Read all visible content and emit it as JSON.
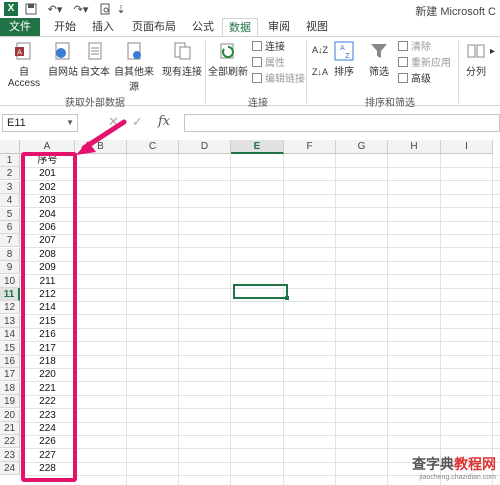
{
  "app": {
    "title": "新建 Microsoft C",
    "logo": "X"
  },
  "quick_access": {
    "icons": [
      "save-icon",
      "undo-icon",
      "redo-icon",
      "print-preview-icon"
    ]
  },
  "tabs": [
    {
      "label": "文件"
    },
    {
      "label": "开始"
    },
    {
      "label": "插入"
    },
    {
      "label": "页面布局"
    },
    {
      "label": "公式"
    },
    {
      "label": "数据"
    },
    {
      "label": "审阅"
    },
    {
      "label": "视图"
    }
  ],
  "active_tab": "数据",
  "ribbon": {
    "get_external": {
      "buttons": [
        "自 Access",
        "自网站",
        "自文本",
        "自其他来源",
        "现有连接"
      ],
      "label": "获取外部数据"
    },
    "connections": {
      "refresh": "全部刷新",
      "items": [
        "连接",
        "属性",
        "编辑链接"
      ],
      "label": "连接"
    },
    "sort_filter": {
      "sort": "排序",
      "filter": "筛选",
      "items": [
        "清除",
        "重新应用",
        "高级"
      ],
      "label": "排序和筛选"
    },
    "tools": {
      "split": "分列"
    }
  },
  "formula_bar": {
    "name_box": "E11",
    "fx": "fx",
    "content": ""
  },
  "columns": [
    "A",
    "B",
    "C",
    "D",
    "E",
    "F",
    "G",
    "H",
    "I"
  ],
  "selected_column": "E",
  "rows": [
    "1",
    "2",
    "3",
    "4",
    "5",
    "6",
    "7",
    "8",
    "9",
    "10",
    "11",
    "12",
    "13",
    "14",
    "15",
    "16",
    "17",
    "18",
    "19",
    "20",
    "21",
    "22",
    "23",
    "24"
  ],
  "selected_row": "11",
  "column_a": [
    "序号",
    "201",
    "202",
    "203",
    "204",
    "206",
    "207",
    "208",
    "209",
    "211",
    "212",
    "214",
    "215",
    "216",
    "217",
    "218",
    "220",
    "221",
    "222",
    "223",
    "224",
    "226",
    "227",
    "228"
  ],
  "colors": {
    "excel_green": "#217346",
    "annotation": "#e4126b"
  },
  "watermark": {
    "line1_a": "查字典",
    "line1_b": "教程网",
    "line2": "jiaocheng.chazidian.com"
  }
}
